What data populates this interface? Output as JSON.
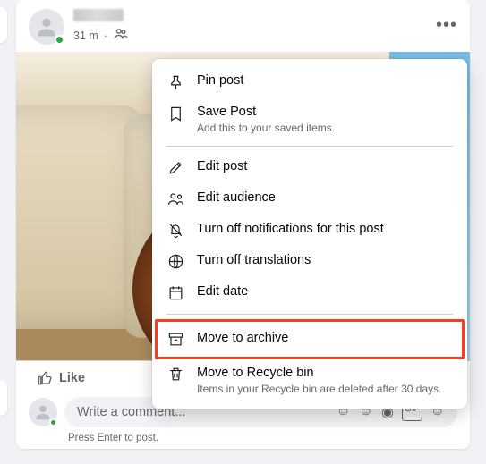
{
  "post": {
    "timestamp": "31 m",
    "audience_icon": "friends-icon"
  },
  "actions": {
    "like_label": "Like"
  },
  "comment": {
    "placeholder": "Write a comment...",
    "hint": "Press Enter to post."
  },
  "menu": {
    "items": [
      {
        "icon": "pin-icon",
        "label": "Pin post"
      },
      {
        "icon": "bookmark-icon",
        "label": "Save Post",
        "sub": "Add this to your saved items."
      }
    ],
    "items2": [
      {
        "icon": "pencil-icon",
        "label": "Edit post"
      },
      {
        "icon": "audience-icon",
        "label": "Edit audience"
      },
      {
        "icon": "bell-off-icon",
        "label": "Turn off notifications for this post"
      },
      {
        "icon": "globe-icon",
        "label": "Turn off translations"
      },
      {
        "icon": "calendar-icon",
        "label": "Edit date"
      }
    ],
    "items3": [
      {
        "icon": "archive-icon",
        "label": "Move to archive",
        "highlight": true
      },
      {
        "icon": "trash-icon",
        "label": "Move to Recycle bin",
        "sub": "Items in your Recycle bin are deleted after 30 days."
      }
    ]
  }
}
